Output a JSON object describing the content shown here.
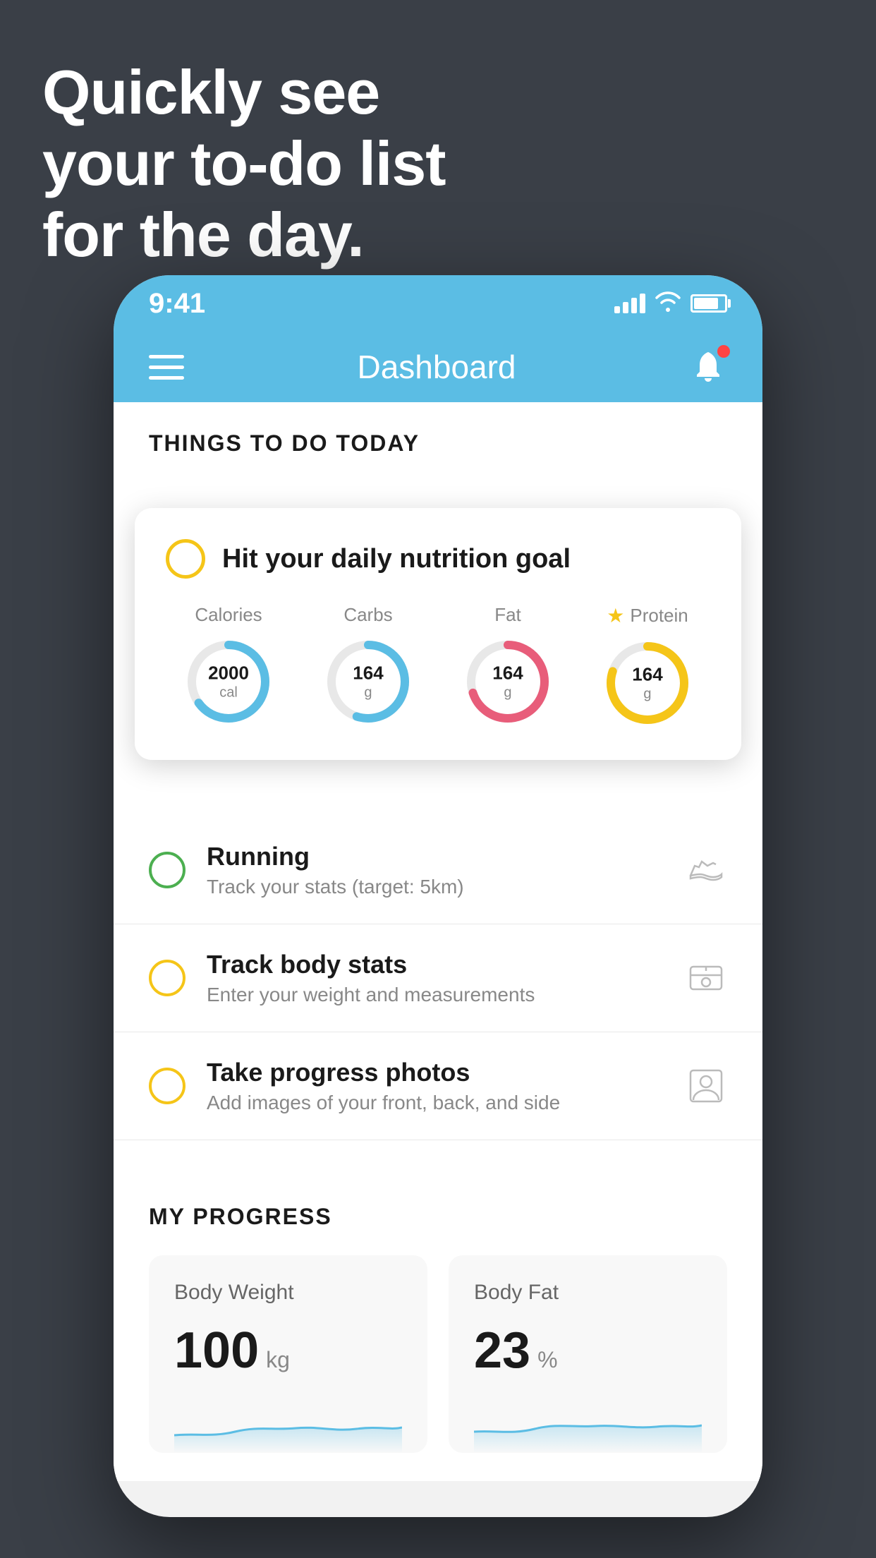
{
  "headline": {
    "line1": "Quickly see",
    "line2": "your to-do list",
    "line3": "for the day."
  },
  "status_bar": {
    "time": "9:41"
  },
  "nav": {
    "title": "Dashboard"
  },
  "things_section": {
    "header": "THINGS TO DO TODAY"
  },
  "nutrition_card": {
    "title": "Hit your daily nutrition goal",
    "metrics": [
      {
        "label": "Calories",
        "value": "2000",
        "unit": "cal",
        "color": "#5bbde4",
        "track_pct": 65
      },
      {
        "label": "Carbs",
        "value": "164",
        "unit": "g",
        "color": "#5bbde4",
        "track_pct": 55
      },
      {
        "label": "Fat",
        "value": "164",
        "unit": "g",
        "color": "#e85d7a",
        "track_pct": 70
      },
      {
        "label": "Protein",
        "value": "164",
        "unit": "g",
        "color": "#f5c518",
        "track_pct": 80,
        "starred": true
      }
    ]
  },
  "todo_items": [
    {
      "title": "Running",
      "subtitle": "Track your stats (target: 5km)",
      "circle_color": "green",
      "icon": "shoe"
    },
    {
      "title": "Track body stats",
      "subtitle": "Enter your weight and measurements",
      "circle_color": "yellow",
      "icon": "scale"
    },
    {
      "title": "Take progress photos",
      "subtitle": "Add images of your front, back, and side",
      "circle_color": "yellow",
      "icon": "person"
    }
  ],
  "progress_section": {
    "header": "MY PROGRESS",
    "cards": [
      {
        "title": "Body Weight",
        "value": "100",
        "unit": "kg"
      },
      {
        "title": "Body Fat",
        "value": "23",
        "unit": "%"
      }
    ]
  }
}
